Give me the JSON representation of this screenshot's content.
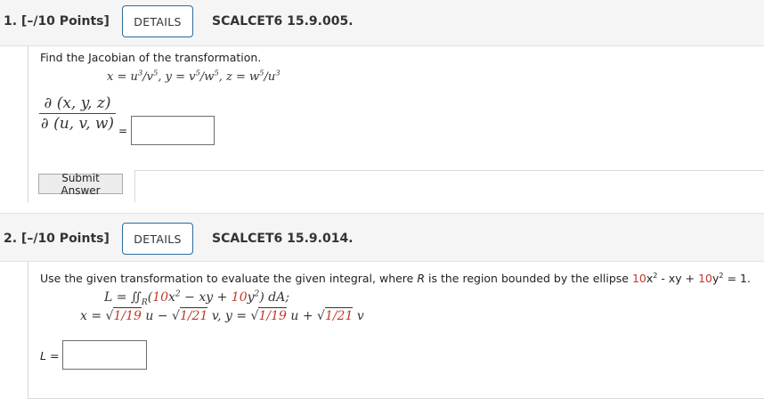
{
  "q1": {
    "number": "1. [–/10 Points]",
    "details_label": "DETAILS",
    "code": "SCALCET6 15.9.005.",
    "prompt": "Find the Jacobian of the transformation.",
    "equation": {
      "x_lhs": "x = u",
      "x_exp1": "3",
      "x_mid": "/v",
      "x_exp2": "5",
      "y_lhs": ",  y = v",
      "y_exp1": "5",
      "y_mid": "/w",
      "y_exp2": "5",
      "z_lhs": ",  z = w",
      "z_exp1": "5",
      "z_mid": "/u",
      "z_exp2": "3"
    },
    "jacobian_numerator": "∂ (x, y, z)",
    "jacobian_denominator": "∂ (u, v, w)",
    "equals": "=",
    "answer_value": "",
    "submit_label": "Submit Answer"
  },
  "q2": {
    "number": "2. [–/10 Points]",
    "details_label": "DETAILS",
    "code": "SCALCET6 15.9.014.",
    "prompt_start": "Use the given transformation to evaluate the given integral, where ",
    "prompt_R": "R",
    "prompt_mid": " is the region bounded by the ellipse ",
    "ellipse": {
      "c1": "10",
      "t1": "x",
      "e1": "2",
      "op1": " - xy + ",
      "c2": "10",
      "t2": "y",
      "e2": "2",
      "rhs": " = 1."
    },
    "integral": {
      "lhs": "L = ∬",
      "sub": "R",
      "open": "(",
      "c1": "10",
      "x2": "x",
      "e1": "2",
      "op": " − xy + ",
      "c2": "10",
      "y2": "y",
      "e2": "2",
      "close": ") dA;"
    },
    "transform": {
      "x_lhs": "x = √",
      "r1": "1/19",
      "t1": " u − √",
      "r2": "1/21",
      "t2": " v,  y = √",
      "r3": "1/19",
      "t3": " u + √",
      "r4": "1/21",
      "t4": " v"
    },
    "answer_label": "L =",
    "answer_value": ""
  },
  "colors": {
    "accent_border": "#2b6c9e",
    "randomized_value": "#c0392b",
    "header_bg": "#f5f5f5"
  }
}
